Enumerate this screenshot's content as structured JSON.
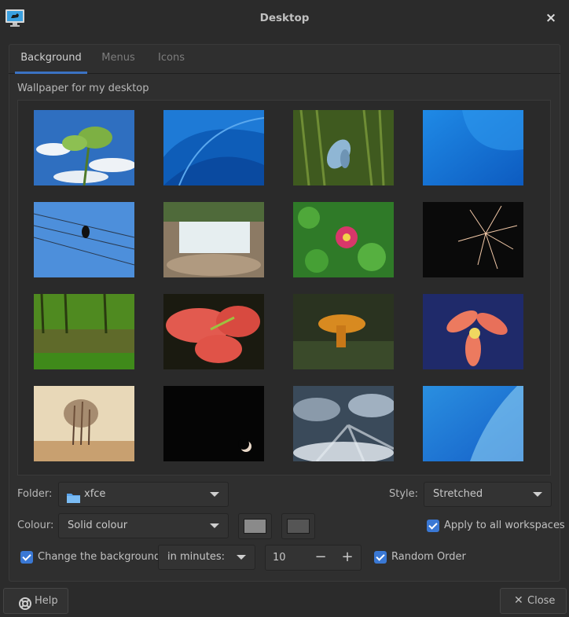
{
  "window": {
    "title": "Desktop",
    "app_icon": "monitor-icon",
    "close_glyph": "×"
  },
  "tabs": [
    {
      "label": "Background",
      "active": true
    },
    {
      "label": "Menus",
      "active": false
    },
    {
      "label": "Icons",
      "active": false
    }
  ],
  "wallpaper": {
    "section_label": "Wallpaper for my desktop",
    "thumbnails": [
      "leaf-sky",
      "blue-waves",
      "butterfly",
      "blue-gradient",
      "bird-wires",
      "waterfall",
      "pink-flower",
      "fireworks",
      "green-forest",
      "red-lily",
      "mushroom",
      "orange-lily",
      "trees-sepia",
      "night-moon",
      "clouds-rays",
      "light-blue-swirl"
    ]
  },
  "folder": {
    "label": "Folder:",
    "value": "xfce",
    "icon": "folder-icon"
  },
  "style": {
    "label": "Style:",
    "value": "Stretched"
  },
  "colour": {
    "label": "Colour:",
    "value": "Solid colour",
    "swatch1": "#8a8a8a",
    "swatch2": "#555555"
  },
  "apply_all": {
    "label": "Apply to all workspaces",
    "checked": true
  },
  "change_bg": {
    "label": "Change the background",
    "checked": true,
    "interval_unit": "in minutes:",
    "interval_value": "10",
    "minus": "−",
    "plus": "+"
  },
  "random_order": {
    "label": "Random Order",
    "checked": true
  },
  "buttons": {
    "help": "Help",
    "close": "Close",
    "help_icon": "help-lifebuoy-icon",
    "close_icon": "close-icon"
  },
  "colors": {
    "accent": "#3b73c4",
    "background": "#2b2b2b"
  }
}
